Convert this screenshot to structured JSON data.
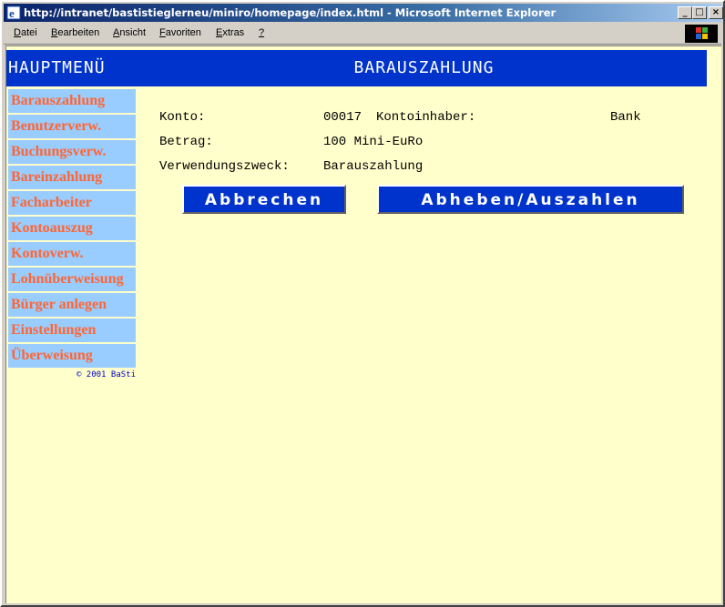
{
  "window": {
    "title": "http://intranet/bastistieglerneu/miniro/homepage/index.html - Microsoft Internet Explorer",
    "minimize": "_",
    "maximize": "□",
    "close": "×"
  },
  "menubar": {
    "items": [
      {
        "underline": "D",
        "rest": "atei"
      },
      {
        "underline": "B",
        "rest": "earbeiten"
      },
      {
        "underline": "A",
        "rest": "nsicht"
      },
      {
        "underline": "F",
        "rest": "avoriten"
      },
      {
        "underline": "E",
        "rest": "xtras"
      },
      {
        "underline": "?",
        "rest": ""
      }
    ]
  },
  "header": {
    "left": "HAUPTMENÜ",
    "right": "BARAUSZAHLUNG"
  },
  "sidebar": {
    "items": [
      "Barauszahlung",
      "Benutzerverw.",
      "Buchungsverw.",
      "Bareinzahlung",
      "Facharbeiter",
      "Kontoauszug",
      "Kontoverw.",
      "Lohnüberweisung",
      "Bürger anlegen",
      "Einstellungen",
      "Überweisung"
    ],
    "copyright": "© 2001 BaSti"
  },
  "form": {
    "konto_label": "Konto:",
    "konto_value": "00017",
    "inhaber_label": "Kontoinhaber:",
    "inhaber_value": "Bank",
    "betrag_label": "Betrag:",
    "betrag_value": "100 Mini-EuRo",
    "zweck_label": "Verwendungszweck:",
    "zweck_value": "Barauszahlung"
  },
  "buttons": {
    "cancel": "Abbrechen",
    "withdraw": "Abheben/Auszahlen"
  },
  "colors": {
    "accent": "#0033cc",
    "sidebar_bg": "#99ccff",
    "sidebar_text": "#ff6633",
    "page_bg": "#ffffcc"
  }
}
